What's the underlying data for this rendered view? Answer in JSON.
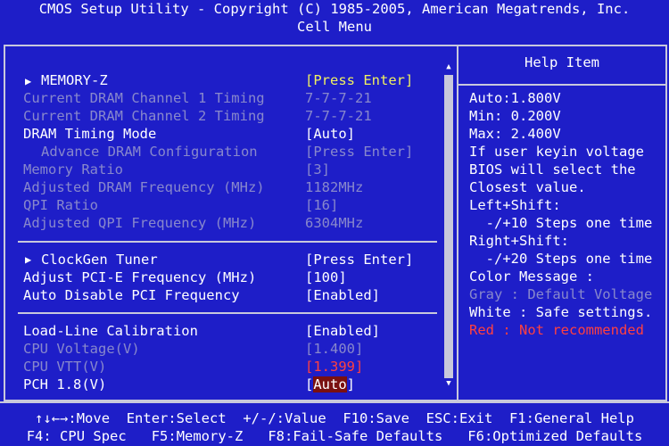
{
  "header": {
    "title": "CMOS Setup Utility - Copyright (C) 1985-2005, American Megatrends, Inc.",
    "menu": "Cell Menu"
  },
  "items": [
    {
      "label": "MEMORY-Z",
      "value": "[Press Enter]",
      "submenu": true
    },
    {
      "label": "Current DRAM Channel 1 Timing",
      "value": "7-7-7-21"
    },
    {
      "label": "Current DRAM Channel 2 Timing",
      "value": "7-7-7-21"
    },
    {
      "label": "DRAM Timing Mode",
      "value": "[Auto]"
    },
    {
      "label": "Advance DRAM Configuration",
      "value": "[Press Enter]"
    },
    {
      "label": "Memory Ratio",
      "value": "[3]"
    },
    {
      "label": "Adjusted DRAM Frequency (MHz)",
      "value": "1182MHz"
    },
    {
      "label": "QPI Ratio",
      "value": "[16]"
    },
    {
      "label": "Adjusted QPI Frequency (MHz)",
      "value": "6304MHz"
    },
    {
      "label": "ClockGen Tuner",
      "value": "[Press Enter]",
      "submenu": true
    },
    {
      "label": "Adjust PCI-E Frequency (MHz)",
      "value": "[100]"
    },
    {
      "label": "Auto Disable PCI Frequency",
      "value": "[Enabled]"
    },
    {
      "label": "Load-Line Calibration",
      "value": "[Enabled]"
    },
    {
      "label": "CPU Voltage(V)",
      "value": "[1.400]"
    },
    {
      "label": "CPU VTT(V)",
      "value": "[1.399]"
    },
    {
      "label": "PCH 1.8(V)",
      "value_open": "[",
      "value_sel": "Auto",
      "value_close": "]"
    }
  ],
  "help": {
    "title": "Help Item",
    "lines": [
      "Auto:1.800V",
      "Min: 0.200V",
      "Max: 2.400V",
      "If user keyin voltage",
      "BIOS will select the",
      "Closest value.",
      "Left+Shift:",
      "  -/+10 Steps one time",
      "Right+Shift:",
      "  -/+20 Steps one time",
      "Color Message :",
      "Gray : Default Voltage",
      "White : Safe settings.",
      "Red : Not recommended"
    ]
  },
  "footer": {
    "line1": "↑↓←→:Move  Enter:Select  +/-/:Value  F10:Save  ESC:Exit  F1:General Help",
    "line2": "F4: CPU Spec   F5:Memory-Z   F8:Fail-Safe Defaults   F6:Optimized Defaults"
  },
  "colors": {
    "background": "#1e1ec8",
    "active_text": "#ffffff",
    "disabled_text": "#8888cc",
    "value_text": "#f0f060",
    "warning_text": "#ff4040"
  }
}
